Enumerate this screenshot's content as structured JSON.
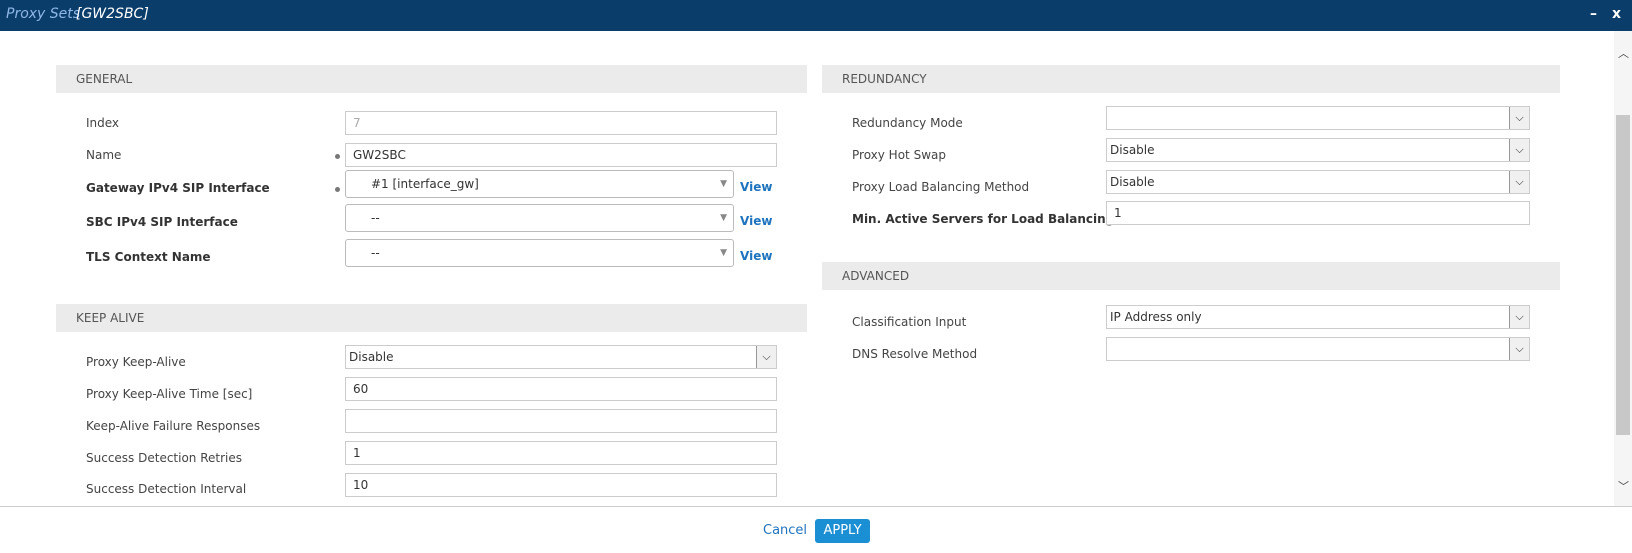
{
  "window": {
    "title_section": "Proxy Sets",
    "title_item": "[GW2SBC]",
    "minimize_label": "–",
    "close_label": "x"
  },
  "general": {
    "header": "GENERAL",
    "index_label": "Index",
    "index_value": "7",
    "name_label": "Name",
    "name_value": "GW2SBC",
    "gw_label": "Gateway IPv4 SIP Interface",
    "gw_value": "#1 [interface_gw]",
    "sbc_label": "SBC IPv4 SIP Interface",
    "sbc_value": "--",
    "tls_label": "TLS Context Name",
    "tls_value": "--",
    "view_label": "View"
  },
  "keepalive": {
    "header": "KEEP ALIVE",
    "proxy_keepalive_label": "Proxy Keep-Alive",
    "proxy_keepalive_value": "Disable",
    "keepalive_time_label": "Proxy Keep-Alive Time [sec]",
    "keepalive_time_value": "60",
    "failure_responses_label": "Keep-Alive Failure Responses",
    "failure_responses_value": "",
    "success_retries_label": "Success Detection Retries",
    "success_retries_value": "1",
    "success_interval_label": "Success Detection Interval",
    "success_interval_value": "10"
  },
  "redundancy": {
    "header": "REDUNDANCY",
    "mode_label": "Redundancy Mode",
    "mode_value": "",
    "hot_swap_label": "Proxy Hot Swap",
    "hot_swap_value": "Disable",
    "lb_method_label": "Proxy Load Balancing Method",
    "lb_method_value": "Disable",
    "min_active_label": "Min. Active Servers for Load Balancing",
    "min_active_value": "1"
  },
  "advanced": {
    "header": "ADVANCED",
    "classification_label": "Classification Input",
    "classification_value": "IP Address only",
    "dns_label": "DNS Resolve Method",
    "dns_value": ""
  },
  "footer": {
    "cancel_label": "Cancel",
    "apply_label": "APPLY"
  },
  "icons": {
    "select_arrow": "chevron-down-icon",
    "combo_caret": "caret-down-icon",
    "scroll_up": "chevron-up-icon",
    "scroll_down": "chevron-down-icon"
  },
  "colors": {
    "titlebar": "#0b3d6b",
    "accent": "#1a8fd4",
    "link": "#1e73be",
    "section_header_bg": "#ebebeb"
  }
}
